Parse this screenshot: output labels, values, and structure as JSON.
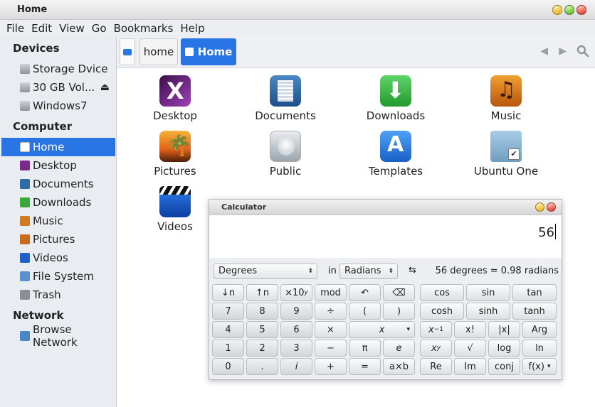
{
  "window": {
    "title": "Home"
  },
  "menubar": [
    "File",
    "Edit",
    "View",
    "Go",
    "Bookmarks",
    "Help"
  ],
  "sidebar": {
    "devices_heading": "Devices",
    "devices": [
      {
        "label": "Storage Dvice",
        "icon": "drive-icon"
      },
      {
        "label": "30 GB Vol...",
        "icon": "drive-icon",
        "eject": "⏏"
      },
      {
        "label": "Windows7",
        "icon": "drive-icon"
      }
    ],
    "computer_heading": "Computer",
    "computer": [
      {
        "label": "Home",
        "icon": "home-icon",
        "active": true
      },
      {
        "label": "Desktop",
        "icon": "desktop-icon"
      },
      {
        "label": "Documents",
        "icon": "documents-icon"
      },
      {
        "label": "Downloads",
        "icon": "downloads-icon"
      },
      {
        "label": "Music",
        "icon": "music-icon"
      },
      {
        "label": "Pictures",
        "icon": "pictures-icon"
      },
      {
        "label": "Videos",
        "icon": "videos-icon"
      },
      {
        "label": "File System",
        "icon": "filesystem-icon"
      },
      {
        "label": "Trash",
        "icon": "trash-icon"
      }
    ],
    "network_heading": "Network",
    "network": [
      {
        "label": "Browse Network",
        "icon": "network-icon"
      }
    ]
  },
  "toolbar": {
    "crumb_home": "home",
    "crumb_current": "Home"
  },
  "files": [
    {
      "label": "Desktop"
    },
    {
      "label": "Documents"
    },
    {
      "label": "Downloads"
    },
    {
      "label": "Music"
    },
    {
      "label": "Pictures"
    },
    {
      "label": "Public"
    },
    {
      "label": "Templates"
    },
    {
      "label": "Ubuntu One"
    },
    {
      "label": "Videos"
    }
  ],
  "calculator": {
    "title": "Calculator",
    "display": "56",
    "from_unit": "Degrees",
    "in_label": "in",
    "to_unit": "Radians",
    "swap": "⇆",
    "result": "56 degrees = 0.98 radians",
    "keys": {
      "row1": [
        "↓n",
        "↑n",
        "×10",
        "mod",
        "↶",
        "⌫",
        "cos",
        "sin",
        "tan"
      ],
      "row2": [
        "7",
        "8",
        "9",
        "÷",
        "(",
        ")",
        "cosh",
        "sinh",
        "tanh"
      ],
      "row3": [
        "4",
        "5",
        "6",
        "×",
        "x",
        "x",
        "x!",
        "|x|",
        "Arg"
      ],
      "row4": [
        "1",
        "2",
        "3",
        "−",
        "π",
        "e",
        "x",
        "√",
        "log",
        "ln"
      ],
      "row5": [
        "0",
        ".",
        "i",
        "+",
        "=",
        "a×b",
        "Re",
        "Im",
        "conj",
        "f(x)"
      ]
    },
    "key_sups": {
      "x10": "y",
      "inverse": "−1",
      "power": "y"
    },
    "dropdown_glyph": "▾",
    "select_glyph": "⬍"
  },
  "colors": {
    "accent": "#2a75e6",
    "sidebar_bg": "#e9edf1"
  }
}
